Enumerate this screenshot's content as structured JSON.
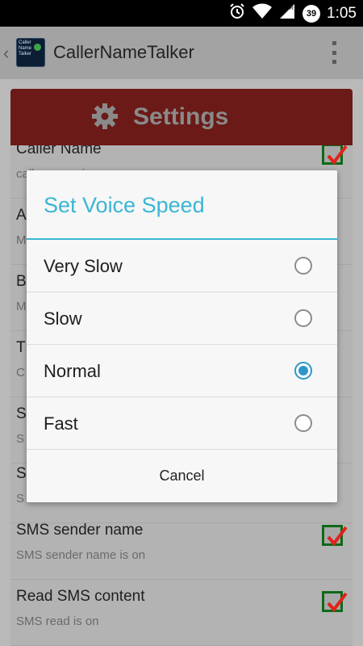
{
  "status_bar": {
    "time": "1:05",
    "battery": "39",
    "icons": [
      "alarm-icon",
      "wifi-icon",
      "signal-icon",
      "battery-icon"
    ]
  },
  "action_bar": {
    "title": "CallerNameTalker",
    "icon_text": "Caller Name Talker"
  },
  "settings_header": {
    "label": "Settings"
  },
  "list": {
    "items": [
      {
        "title": "Caller Name",
        "summary": "caller name is on",
        "checked": true
      },
      {
        "title": "A",
        "summary": "M",
        "checked": false
      },
      {
        "title": "B",
        "summary": "M",
        "checked": false
      },
      {
        "title": "T",
        "summary": "C",
        "checked": false
      },
      {
        "title": "S",
        "summary": "S",
        "checked": false
      },
      {
        "title": "S",
        "summary": "S",
        "checked": false
      },
      {
        "title": "SMS sender name",
        "summary": "SMS sender name is on",
        "checked": true
      },
      {
        "title": "Read SMS content",
        "summary": "SMS read is on",
        "checked": true
      }
    ]
  },
  "dialog": {
    "title": "Set Voice Speed",
    "options": [
      {
        "label": "Very Slow",
        "selected": false
      },
      {
        "label": "Slow",
        "selected": false
      },
      {
        "label": "Normal",
        "selected": true
      },
      {
        "label": "Fast",
        "selected": false
      }
    ],
    "cancel_label": "Cancel"
  },
  "colors": {
    "accent": "#3ab6d4",
    "header_red": "#c62828",
    "check_green": "#1b8a2b",
    "radio_blue": "#2f97c7"
  }
}
